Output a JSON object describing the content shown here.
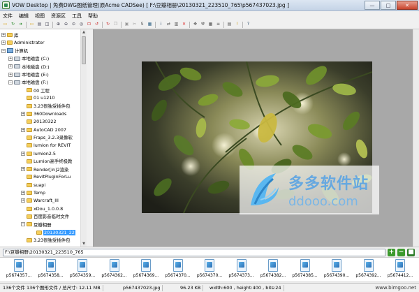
{
  "window": {
    "title": "VOW Desktop | 免费DWG图纸管理(原Acme CADSee) [ F:\\豆瓣相册\\20130321_223510_765\\p5674370​23.jpg ]",
    "minimize_label": "—",
    "maximize_label": "□",
    "close_label": "✕"
  },
  "menu": {
    "items": [
      "文件",
      "编辑",
      "视图",
      "资源区",
      "工具",
      "帮助"
    ]
  },
  "toolbar": {
    "icons": [
      "open-folder-icon",
      "refresh-icon",
      "green-arrow-icon",
      "folder-icon",
      "sheet-icon",
      "dual-view-icon",
      "zoom-in-icon",
      "zoom-out-icon",
      "zoom-fit-icon",
      "zoom-100-icon",
      "zoom-window-icon",
      "rotate-left-icon",
      "rotate-right-icon",
      "copy-icon",
      "paste-icon",
      "cut-icon",
      "s-icon",
      "image-icon",
      "info-icon",
      "convert-icon",
      "print-icon",
      "delete-icon",
      "move-icon",
      "tools-icon",
      "grid-icon",
      "list-icon",
      "table-icon",
      "warning-icon",
      "help-icon"
    ]
  },
  "tree": {
    "items": [
      {
        "label": "库",
        "kind": "folder",
        "level": 1,
        "expander": "+"
      },
      {
        "label": "Administrator",
        "kind": "folder",
        "level": 1,
        "expander": "+"
      },
      {
        "label": "计算机",
        "kind": "pc",
        "level": 1,
        "expander": "−"
      },
      {
        "label": "本地磁盘 (C:)",
        "kind": "drive",
        "level": 2,
        "expander": "+"
      },
      {
        "label": "本地磁盘 (D:)",
        "kind": "drive",
        "level": 2,
        "expander": "+"
      },
      {
        "label": "本地磁盘 (E:)",
        "kind": "drive",
        "level": 2,
        "expander": "+"
      },
      {
        "label": "本地磁盘 (F:)",
        "kind": "drive",
        "level": 2,
        "expander": "−"
      },
      {
        "label": "00 工程",
        "kind": "folder",
        "level": 3,
        "expander": ""
      },
      {
        "label": "01 u1210",
        "kind": "folder",
        "level": 3,
        "expander": ""
      },
      {
        "label": "3.23很独受插件包",
        "kind": "folder",
        "level": 3,
        "expander": ""
      },
      {
        "label": "360Downloads",
        "kind": "folder",
        "level": 3,
        "expander": "+"
      },
      {
        "label": "20130322",
        "kind": "folder",
        "level": 3,
        "expander": ""
      },
      {
        "label": "AutoCAD 2007",
        "kind": "folder",
        "level": 3,
        "expander": "+"
      },
      {
        "label": "Fraps_3.2.3录像软",
        "kind": "folder",
        "level": 3,
        "expander": ""
      },
      {
        "label": "lumion for REVIT",
        "kind": "folder",
        "level": 3,
        "expander": ""
      },
      {
        "label": "lumion2.5",
        "kind": "folder",
        "level": 3,
        "expander": "+"
      },
      {
        "label": "Lumion高手终极教",
        "kind": "folder",
        "level": 3,
        "expander": ""
      },
      {
        "label": "Render[in]2渲染",
        "kind": "folder",
        "level": 3,
        "expander": "+"
      },
      {
        "label": "RevitPluginForLu",
        "kind": "folder",
        "level": 3,
        "expander": ""
      },
      {
        "label": "suapi",
        "kind": "folder",
        "level": 3,
        "expander": ""
      },
      {
        "label": "Temp",
        "kind": "folder",
        "level": 3,
        "expander": "+"
      },
      {
        "label": "Warcraft_III",
        "kind": "folder",
        "level": 3,
        "expander": "+"
      },
      {
        "label": "xDou_1.0.0.8",
        "kind": "folder",
        "level": 3,
        "expander": ""
      },
      {
        "label": "百度影音临时文件",
        "kind": "folder",
        "level": 3,
        "expander": ""
      },
      {
        "label": "豆瓣相册",
        "kind": "folder",
        "level": 3,
        "expander": "−"
      },
      {
        "label": "20130321_22",
        "kind": "folder",
        "level": 4,
        "expander": "",
        "selected": true
      },
      {
        "label": "3.23很独受插件包",
        "kind": "folder",
        "level": 3,
        "expander": ""
      }
    ]
  },
  "pathbar": {
    "value": "F:\\豆瓣相册\\20130321_223510_765",
    "buttons": [
      {
        "name": "add-button",
        "label": "+",
        "color": "#3c9a2e"
      },
      {
        "name": "remove-button",
        "label": "−",
        "color": "#3c9a2e"
      },
      {
        "name": "apply-button",
        "label": "■",
        "color": "#2f7d2a"
      }
    ]
  },
  "thumbnails": [
    "p5674357...",
    "p5674358...",
    "p5674359...",
    "p5674362...",
    "p5674369...",
    "p5674370...",
    "p5674370...",
    "p5674373...",
    "p5674382...",
    "p5674385...",
    "p5674390...",
    "p5674392...",
    "p5674412..."
  ],
  "status": {
    "counts": "136个文件 136个图形文件 / 总尺寸: 12.11 MB",
    "filename": "p5674370​23.jpg",
    "filesize": "96.23 KB",
    "dimensions": "width:600 , height:400 , bits:24",
    "url": "www.bimgoo.net"
  },
  "watermark": {
    "brand_cn": "多多软件站",
    "brand_en": "ddooo.com"
  },
  "colors": {
    "selection": "#3399ff",
    "preview_bg": "#a8a8a8",
    "watermark_blue": "#66a8e0"
  }
}
